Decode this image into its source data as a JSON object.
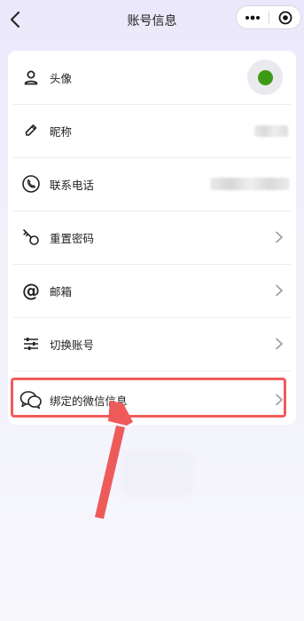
{
  "header": {
    "title": "账号信息",
    "back_icon": "chevron-left-icon",
    "more_icon": "more-dots-icon",
    "close_icon": "record-circle-icon"
  },
  "rows": [
    {
      "id": "avatar",
      "label": "头像",
      "icon": "user-icon",
      "value_type": "avatar",
      "chevron": false
    },
    {
      "id": "nickname",
      "label": "昵称",
      "icon": "pencil-icon",
      "value_type": "blurred",
      "chevron": false
    },
    {
      "id": "phone",
      "label": "联系电话",
      "icon": "phone-icon",
      "value_type": "blurred",
      "chevron": false
    },
    {
      "id": "password",
      "label": "重置密码",
      "icon": "key-icon",
      "chevron": true
    },
    {
      "id": "email",
      "label": "邮箱",
      "icon": "at-icon",
      "chevron": true
    },
    {
      "id": "switch",
      "label": "切换账号",
      "icon": "sliders-icon",
      "chevron": true
    },
    {
      "id": "wechat",
      "label": "绑定的微信信息",
      "icon": "chat-bubbles-icon",
      "chevron": true,
      "highlighted": true
    }
  ],
  "colors": {
    "highlight": "#f15b5b",
    "avatar_dot": "#3d9a16",
    "background_top": "#ece8fb"
  },
  "annotation": {
    "type": "red-arrow",
    "points_to": "wechat"
  }
}
